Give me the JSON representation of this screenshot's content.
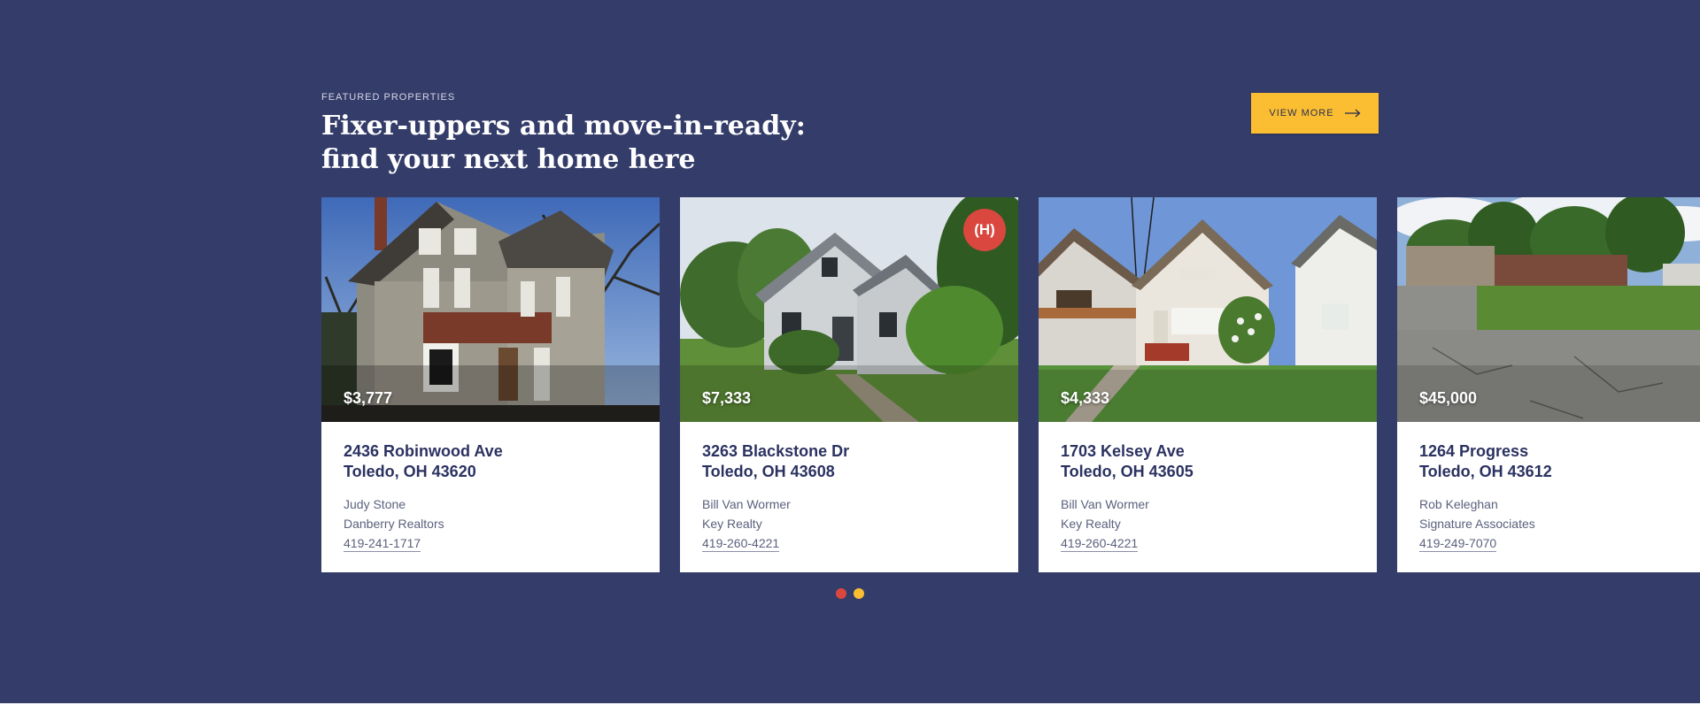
{
  "section": {
    "eyebrow": "FEATURED PROPERTIES",
    "title_line1": "Fixer-uppers and move-in-ready:",
    "title_line2": "find your next home here",
    "view_more_label": "VIEW MORE",
    "arrow_icon": "arrow-right-icon",
    "background_color": "#343c6a",
    "accent_color": "#fbbe32"
  },
  "listings": [
    {
      "price": "$3,777",
      "street": "2436 Robinwood Ave",
      "city": "Toledo, OH 43620",
      "agent": "Judy Stone",
      "agency": "Danberry Realtors",
      "phone": "419-241-1717",
      "photo": "house-photo-victorian"
    },
    {
      "price": "$7,333",
      "street": "3263 Blackstone Dr",
      "city": "Toledo, OH 43608",
      "agent": "Bill Van Wormer",
      "agency": "Key Realty",
      "phone": "419-260-4221",
      "badge": "(H)",
      "badge_color": "#d9473e",
      "photo": "house-photo-cape-cod"
    },
    {
      "price": "$4,333",
      "street": "1703 Kelsey Ave",
      "city": "Toledo, OH 43605",
      "agent": "Bill Van Wormer",
      "agency": "Key Realty",
      "phone": "419-260-4221",
      "photo": "house-photo-bungalow"
    },
    {
      "price": "$45,000",
      "street": "1264 Progress",
      "city": "Toledo, OH 43612",
      "agent": "Rob Keleghan",
      "agency": "Signature Associates",
      "phone": "419-249-7070",
      "photo": "lot-photo-parking"
    }
  ],
  "carousel": {
    "dot_colors": [
      "#d9473e",
      "#fbbe32"
    ]
  }
}
